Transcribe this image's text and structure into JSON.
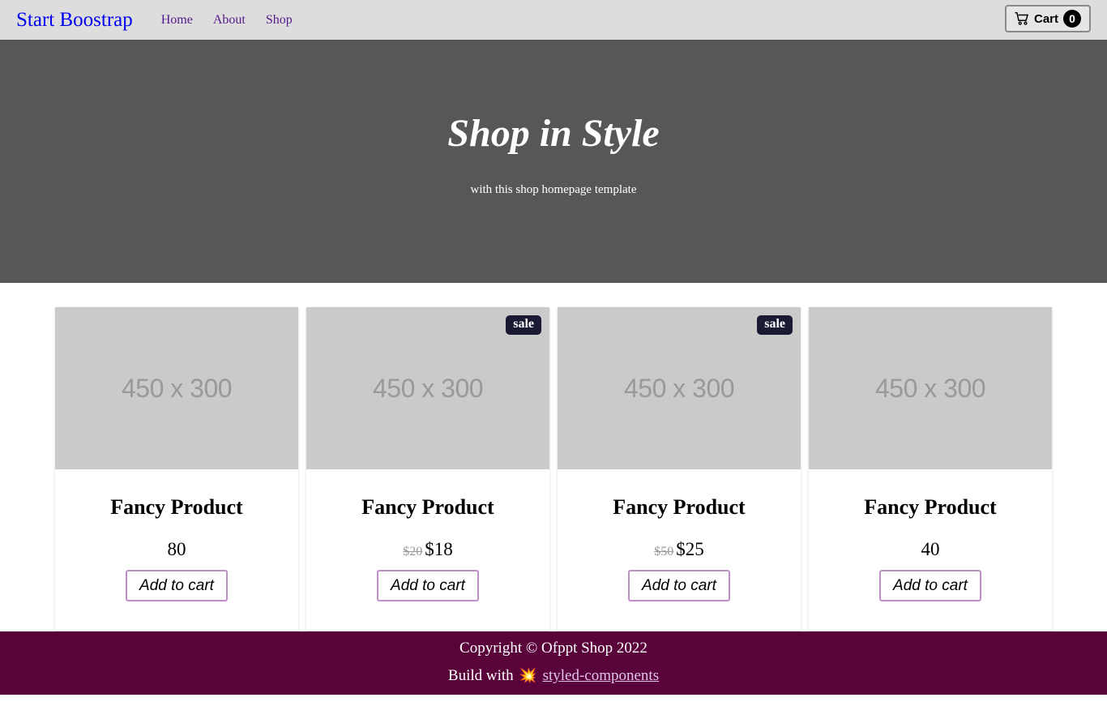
{
  "navbar": {
    "brand": "Start Boostrap",
    "links": [
      "Home",
      "About",
      "Shop"
    ],
    "cart_label": "Cart",
    "cart_count": "0"
  },
  "hero": {
    "title": "Shop in Style",
    "subtitle": "with this shop homepage template"
  },
  "products": [
    {
      "image_text": "450 x 300",
      "title": "Fancy Product",
      "old_price": "",
      "price": "80",
      "sale": "",
      "button": "Add to cart"
    },
    {
      "image_text": "450 x 300",
      "title": "Fancy Product",
      "old_price": "$20",
      "price": "$18",
      "sale": "sale",
      "button": "Add to cart"
    },
    {
      "image_text": "450 x 300",
      "title": "Fancy Product",
      "old_price": "$50",
      "price": "$25",
      "sale": "sale",
      "button": "Add to cart"
    },
    {
      "image_text": "450 x 300",
      "title": "Fancy Product",
      "old_price": "",
      "price": "40",
      "sale": "",
      "button": "Add to cart"
    }
  ],
  "footer": {
    "copyright": "Copyright © Ofppt Shop 2022",
    "built_with": "Build with",
    "link_text": "styled-components"
  },
  "colors": {
    "navbar_bg": "#dddddd",
    "hero_bg": "#575756",
    "footer_bg": "#5a033a",
    "badge_bg": "#1a1a35",
    "button_border": "#c08fc9"
  }
}
